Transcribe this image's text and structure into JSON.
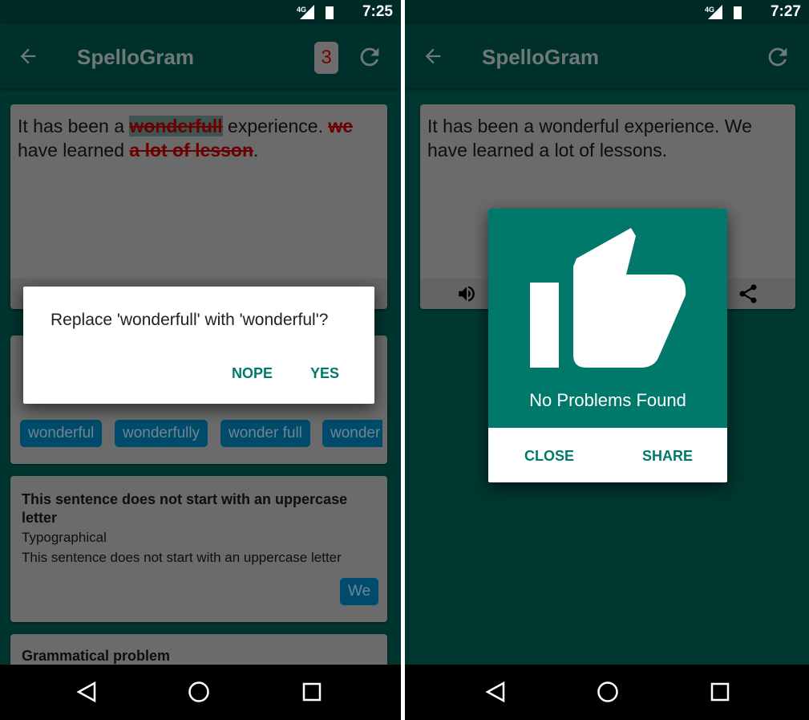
{
  "left": {
    "status": {
      "network": "4G",
      "time": "7:25"
    },
    "appbar": {
      "title": "SpelloGram",
      "error_count": "3"
    },
    "text": {
      "p1": "It has been a ",
      "e1": "wonderfull",
      "p2": " experience. ",
      "e2": "we",
      "p3": " have learned ",
      "e3": "a lot of lesson",
      "p4": "."
    },
    "suggestions": [
      "wonderful",
      "wonderfully",
      "wonder full",
      "wonder"
    ],
    "issue2": {
      "title": "This sentence does not start with an uppercase letter",
      "category": "Typographical",
      "description": "This sentence does not start with an uppercase letter",
      "suggestion": "We"
    },
    "issue3": {
      "title": "Grammatical problem"
    },
    "dialog": {
      "message": "Replace 'wonderfull' with 'wonderful'?",
      "nope": "NOPE",
      "yes": "YES"
    }
  },
  "right": {
    "status": {
      "network": "4G",
      "time": "7:27"
    },
    "appbar": {
      "title": "SpelloGram"
    },
    "text": "It has been a wonderful experience. We have learned a lot of lessons.",
    "dialog": {
      "message": "No Problems Found",
      "close": "CLOSE",
      "share": "SHARE",
      "icon": "thumbs-up-icon"
    }
  },
  "colors": {
    "accent": "#00796b",
    "error": "#6a0000",
    "chip": "#004b6b"
  }
}
